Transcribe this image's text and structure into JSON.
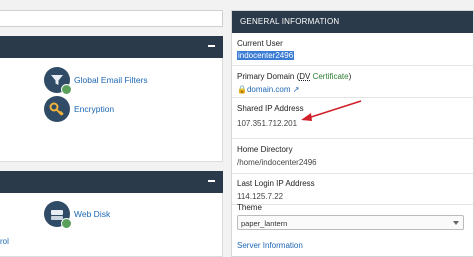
{
  "left": {
    "search": {
      "placeholder": ""
    },
    "email_panel": {
      "tools": [
        {
          "label": "Global Email Filters",
          "icon": "email-filter-icon"
        },
        {
          "label": "Encryption",
          "icon": "encryption-key-icon"
        }
      ]
    },
    "files_panel": {
      "tools": [
        {
          "label": "Web Disk",
          "icon": "web-disk-icon"
        }
      ],
      "cut_link": "rol"
    }
  },
  "general_info": {
    "title": "GENERAL INFORMATION",
    "current_user": {
      "label": "Current User",
      "value": "indocenter2496"
    },
    "primary_domain": {
      "label_prefix": "Primary Domain (",
      "dv": "DV",
      "certificate": " Certificate",
      "label_suffix": ")",
      "value": "domain.com"
    },
    "shared_ip": {
      "label": "Shared IP Address",
      "value": "107.351.712.201"
    },
    "home_directory": {
      "label": "Home Directory",
      "value": "/home/indocenter2496"
    },
    "last_login_ip": {
      "label": "Last Login IP Address",
      "value": "114.125.7.22"
    },
    "theme": {
      "label": "Theme",
      "selected": "paper_lantern"
    },
    "server_info_link": "Server Information"
  },
  "colors": {
    "header_bg": "#2b3a4a",
    "link": "#1d67b3",
    "annotation_arrow": "#d0202a",
    "selection": "#3a7bd5"
  }
}
